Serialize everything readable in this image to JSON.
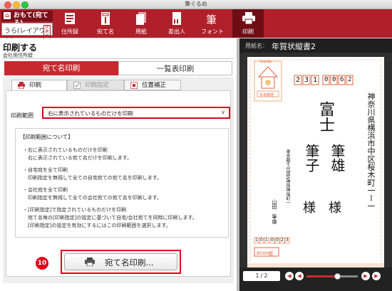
{
  "window": {
    "title": "筆ぐるめ"
  },
  "sender": {
    "home_glyph": "⌂",
    "label": "おもて(宛てる)",
    "layout_label": "うら(レイアウト)",
    "sub_label": "印刷面"
  },
  "toolbar": {
    "items": [
      {
        "label": "住所録",
        "icon": "address-book-icon"
      },
      {
        "label": "宛て名",
        "icon": "address-card-icon"
      },
      {
        "label": "用紙",
        "icon": "paper-icon"
      },
      {
        "label": "差出人",
        "icon": "sender-icon"
      },
      {
        "label": "フォント",
        "icon": "font-icon",
        "glyph": "筆"
      },
      {
        "label": "印刷",
        "icon": "printer-icon",
        "active": true
      }
    ]
  },
  "main": {
    "heading": "印刷する",
    "subheading": "会社用住所録",
    "tabs": [
      {
        "label": "宛て名印刷",
        "active": true
      },
      {
        "label": "一覧表印刷",
        "active": false
      }
    ],
    "subtabs": [
      {
        "label": "印刷",
        "icon": "print-tab-icon"
      },
      {
        "label": "印刷指定",
        "icon": "checkbox-icon",
        "disabled": true
      },
      {
        "label": "位置補正",
        "icon": "position-adjust-icon"
      }
    ],
    "range_label": "印刷範囲",
    "range_value": "右に表示されているものだけを印刷",
    "range_chevron": "∨",
    "info": {
      "title": "【印刷範囲について】",
      "lines": [
        "・右に表示されているものだけを印刷",
        "　右に表示されている宛て名だけを印刷します。",
        "・自宅宛を全て印刷",
        "　印刷指定を無視して全ての自宅宛ての宛て名を印刷します。",
        "・会社宛を全て印刷",
        "　印刷指定を無視して全ての会社宛ての宛て名を印刷します。",
        "・[印刷指定]で指定されているものだけを印刷",
        "　宛て名毎の[印刷指定]の設定に基づいて自宅/会社宛てを同時に印刷します。",
        "　[印刷指定]の設定を有効にするにはこの印刷範囲を選択します。"
      ]
    },
    "print_button": "宛て名印刷...",
    "step_badge": "10"
  },
  "preview": {
    "paper_label": "用紙名：",
    "paper_name": "年賀状縦書2",
    "postal_top": "料金別納",
    "postcode": [
      "2",
      "3",
      "1",
      "0",
      "0",
      "6",
      "2"
    ],
    "address_main": "神奈川県横浜市中区桜木町一ー一",
    "recipient_company": "富士",
    "recipient_name1": "筆雄",
    "recipient_name2": "筆子",
    "honorific1": "様",
    "honorific2": "様",
    "sender_address": "東京都千代田区神田神保町一",
    "sender_name": "山田　筆雄",
    "sender_postcode": [
      "1",
      "0",
      "1",
      "0",
      "0",
      "2",
      "3"
    ],
    "lottery": "8000組",
    "stamp_text": "日本郵便",
    "page_indicator": "1 / 2",
    "progress": 0.6
  },
  "colors": {
    "accent": "#b0202a",
    "highlight": "#e3001b",
    "dark": "#2f2f2f"
  }
}
